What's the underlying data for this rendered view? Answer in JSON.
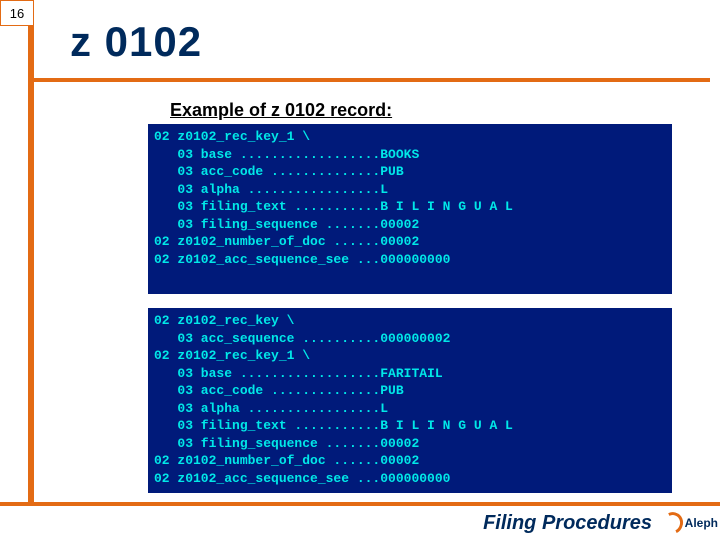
{
  "slide_number": "16",
  "title": "z 0102",
  "subhead": "Example of z 0102 record:",
  "terminal1": "02 z0102_rec_key_1 \\\n   03 base ..................BOOKS\n   03 acc_code ..............PUB\n   03 alpha .................L\n   03 filing_text ...........B I L I N G U A L\n   03 filing_sequence .......00002\n02 z0102_number_of_doc ......00002\n02 z0102_acc_sequence_see ...000000000",
  "terminal2": "02 z0102_rec_key \\\n   03 acc_sequence ..........000000002\n02 z0102_rec_key_1 \\\n   03 base ..................FARITAIL\n   03 acc_code ..............PUB\n   03 alpha .................L\n   03 filing_text ...........B I L I N G U A L\n   03 filing_sequence .......00002\n02 z0102_number_of_doc ......00002\n02 z0102_acc_sequence_see ...000000000",
  "footer_title": "Filing Procedures",
  "logo_text": "Aleph"
}
